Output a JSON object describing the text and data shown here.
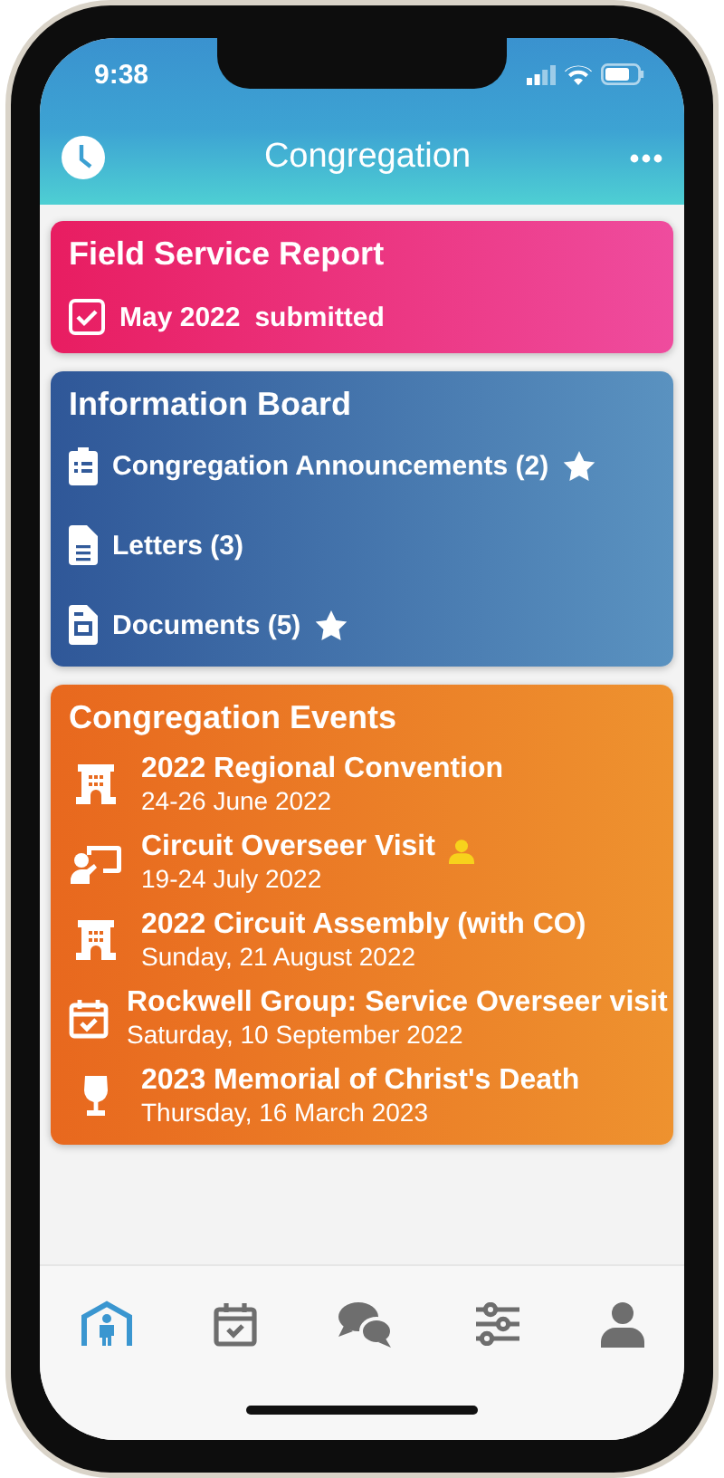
{
  "status_bar": {
    "time": "9:38"
  },
  "header": {
    "title": "Congregation"
  },
  "field_service": {
    "title": "Field Service Report",
    "month": "May 2022",
    "status": "submitted",
    "checked": true
  },
  "information_board": {
    "title": "Information Board",
    "items": [
      {
        "kind": "clipboard",
        "label": "Congregation Announcements (2)",
        "starred": true
      },
      {
        "kind": "document",
        "label": "Letters (3)",
        "starred": false
      },
      {
        "kind": "documents",
        "label": "Documents (5)",
        "starred": true
      }
    ]
  },
  "events": {
    "title": "Congregation Events",
    "items": [
      {
        "kind": "building",
        "title": "2022 Regional Convention",
        "date": "24-26 June 2022",
        "person_badge": false
      },
      {
        "kind": "presenter",
        "title": "Circuit Overseer Visit",
        "date": "19-24 July 2022",
        "person_badge": true
      },
      {
        "kind": "building",
        "title": "2022 Circuit Assembly (with CO)",
        "date": "Sunday, 21 August 2022",
        "person_badge": false
      },
      {
        "kind": "calendar",
        "title": "Rockwell Group: Service Overseer visit",
        "date": "Saturday, 10 September 2022",
        "person_badge": false
      },
      {
        "kind": "glass",
        "title": "2023 Memorial of Christ's Death",
        "date": "Thursday, 16 March 2023",
        "person_badge": false
      }
    ]
  },
  "tab_bar": [
    {
      "kind": "home",
      "selected": true
    },
    {
      "kind": "calendar",
      "selected": false
    },
    {
      "kind": "chat",
      "selected": false
    },
    {
      "kind": "sliders",
      "selected": false
    },
    {
      "kind": "person",
      "selected": false
    }
  ]
}
